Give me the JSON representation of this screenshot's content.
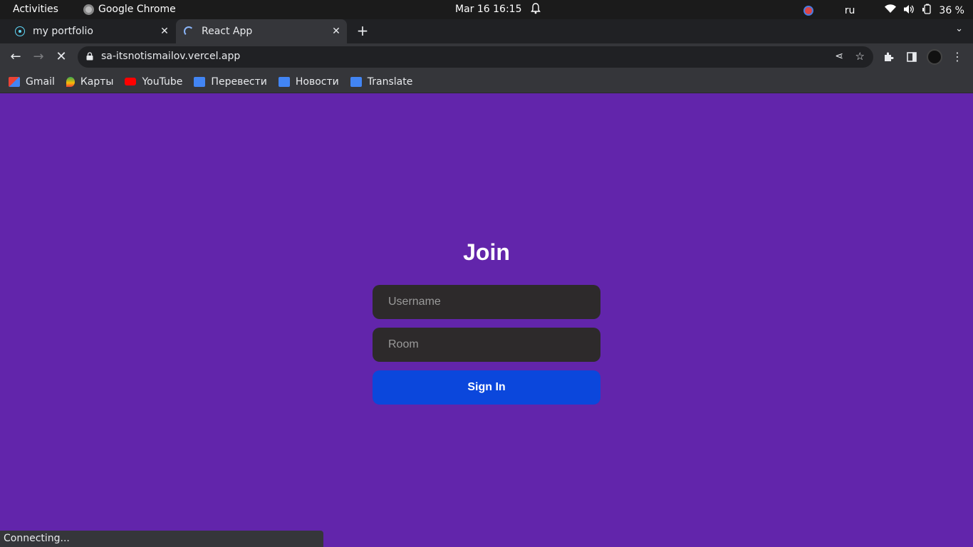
{
  "os": {
    "activities": "Activities",
    "app_name": "Google Chrome",
    "clock": "Mar 16  16:15",
    "lang": "ru",
    "battery": "36 %"
  },
  "tabs": [
    {
      "title": "my portfolio",
      "icon": "react-icon",
      "active": false
    },
    {
      "title": "React App",
      "icon": "loading-spinner-icon",
      "active": true
    }
  ],
  "toolbar": {
    "url": "sa-itsnotismailov.vercel.app"
  },
  "bookmarks": [
    {
      "label": "Gmail",
      "color": "#ea4335"
    },
    {
      "label": "Карты",
      "color": "#34a853"
    },
    {
      "label": "YouTube",
      "color": "#ff0000"
    },
    {
      "label": "Перевести",
      "color": "#4285f4"
    },
    {
      "label": "Новости",
      "color": "#4285f4"
    },
    {
      "label": "Translate",
      "color": "#4285f4"
    }
  ],
  "form": {
    "title": "Join",
    "username_placeholder": "Username",
    "username_value": "",
    "room_placeholder": "Room",
    "room_value": "",
    "submit_label": "Sign In"
  },
  "status_bar": "Connecting...",
  "colors": {
    "page_bg": "#6225ab",
    "input_bg": "#2d2a2b",
    "button_bg": "#0b47dc"
  }
}
